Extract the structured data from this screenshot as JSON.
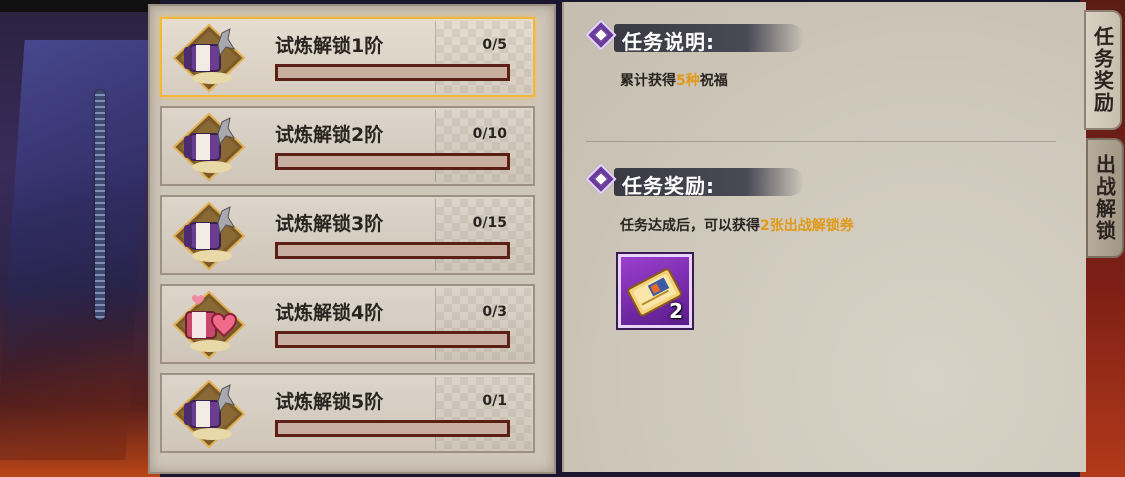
{
  "tasks": [
    {
      "title": "试炼解锁1阶",
      "progress_text": "0/5",
      "progress": 0,
      "icon": "scroll-kunai-icon",
      "selected": true
    },
    {
      "title": "试炼解锁2阶",
      "progress_text": "0/10",
      "progress": 0,
      "icon": "scroll-kunai-icon",
      "selected": false
    },
    {
      "title": "试炼解锁3阶",
      "progress_text": "0/15",
      "progress": 0,
      "icon": "scroll-kunai-icon",
      "selected": false
    },
    {
      "title": "试炼解锁4阶",
      "progress_text": "0/3",
      "progress": 0,
      "icon": "scroll-heart-icon",
      "selected": false
    },
    {
      "title": "试炼解锁5阶",
      "progress_text": "0/1",
      "progress": 0,
      "icon": "scroll-kunai-icon",
      "selected": false
    }
  ],
  "description": {
    "header": "任务说明:",
    "prefix": "累计获得",
    "highlight": "5种",
    "suffix": "祝福"
  },
  "reward": {
    "header": "任务奖励:",
    "prefix": "任务达成后，可以获得",
    "highlight": "2张出战解锁券",
    "item_count": "2",
    "item_icon": "ticket-icon"
  },
  "side_tabs": {
    "active": "任务奖励",
    "inactive": "出战解锁"
  },
  "colors": {
    "highlight": "#e09a18",
    "selected_border": "#f3b73a",
    "reward_bg": "#7a2fb0"
  }
}
